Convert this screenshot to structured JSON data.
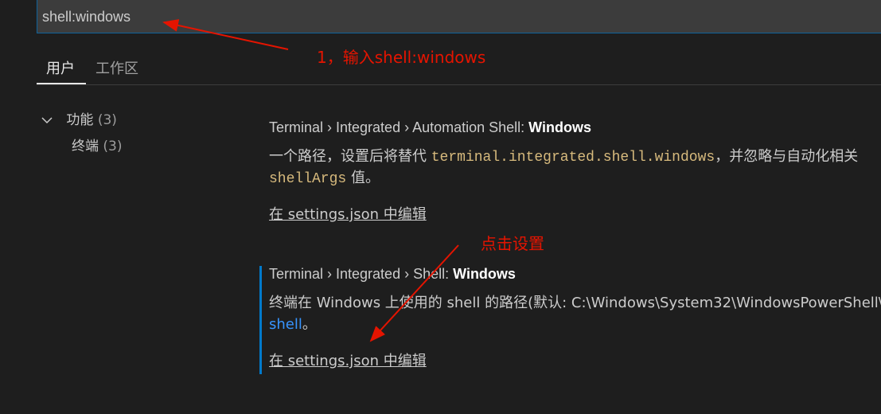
{
  "search": {
    "value": "shell:windows"
  },
  "annotations": {
    "step1": "1，输入shell:windows",
    "click_settings": "点击设置",
    "color": "#e51400"
  },
  "tabs": [
    {
      "label": "用户",
      "active": true
    },
    {
      "label": "工作区",
      "active": false
    }
  ],
  "toc": {
    "features": {
      "label": "功能",
      "count": "(3)"
    },
    "terminal": {
      "label": "终端",
      "count": "(3)"
    }
  },
  "settings": [
    {
      "category": "Terminal › Integrated › Automation Shell: ",
      "name": "Windows",
      "desc_line1_a": "一个路径，设置后将替代 ",
      "desc_line1_code": "terminal.integrated.shell.windows",
      "desc_line1_b": "，并忽略与自动化相关",
      "desc_line2_code": "shellArgs",
      "desc_line2_b": " 值。",
      "edit_link": "在 settings.json 中编辑"
    },
    {
      "category": "Terminal › Integrated › Shell: ",
      "name": "Windows",
      "desc_line1": "终端在 Windows 上使用的 shell 的路径(默认: C:\\Windows\\System32\\WindowsPowerShell\\",
      "desc_line2_link": "shell",
      "desc_line2_b": "。",
      "edit_link": "在 settings.json 中编辑"
    }
  ],
  "colors": {
    "accent": "#007acc",
    "background": "#1e1e1e",
    "code": "#d7ba7d",
    "link": "#3794ff"
  }
}
